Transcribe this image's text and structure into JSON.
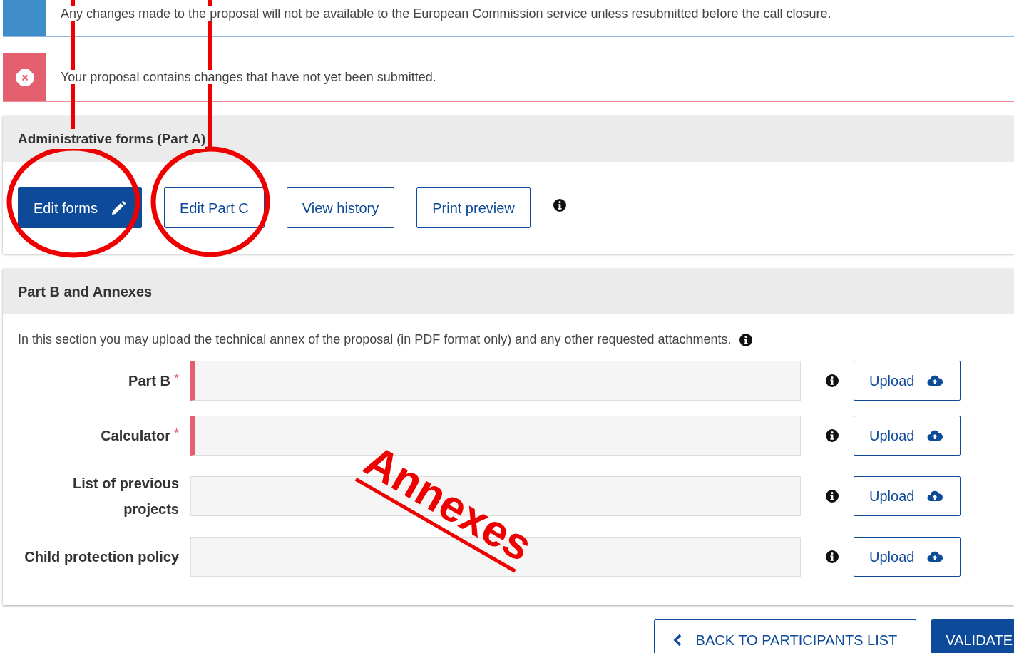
{
  "alerts": [
    {
      "kind": "info",
      "text": "Any changes made to the proposal will not be available to the European Commission service unless resubmitted before the call closure."
    },
    {
      "kind": "error",
      "text": "Your proposal contains changes that have not yet been submitted."
    }
  ],
  "admin_panel": {
    "title": "Administrative forms (Part A)",
    "buttons": [
      {
        "label": "Edit forms",
        "kind": "primary"
      },
      {
        "label": "Edit Part C",
        "kind": "outline"
      },
      {
        "label": "View history",
        "kind": "outline"
      },
      {
        "label": "Print preview",
        "kind": "outline"
      }
    ]
  },
  "annex_panel": {
    "title": "Part B and Annexes",
    "description": "In this section you may upload the technical annex of the proposal (in PDF format only) and any other requested attachments.",
    "rows": [
      {
        "label": "Part B",
        "required": true,
        "button": "Upload"
      },
      {
        "label": "Calculator",
        "required": true,
        "button": "Upload"
      },
      {
        "label": "List of previous projects",
        "required": false,
        "button": "Upload"
      },
      {
        "label": "Child protection policy",
        "required": false,
        "button": "Upload"
      }
    ],
    "required_mark": "*"
  },
  "footer_buttons": [
    {
      "label": "BACK TO PARTICIPANTS LIST",
      "kind": "back"
    },
    {
      "label": "VALIDATE",
      "kind": "primary"
    }
  ],
  "annotation": {
    "label": "Annexes"
  }
}
